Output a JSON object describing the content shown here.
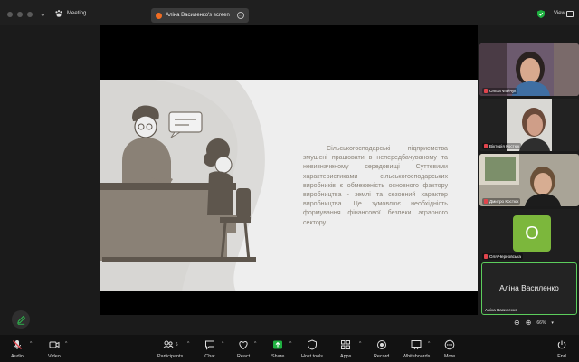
{
  "window": {
    "title": "Meeting",
    "share_pill": "Аліна Василенко's screen",
    "view_label": "View"
  },
  "slide": {
    "paragraph": "Сільськогосподарські підприємства змушені працювати в непередбачуваному та невизначеному середовищі Суттєвими характеристиками сільськогосподарських виробників є обмеженість основного фактору виробництва - землі та сезонний характер виробництва. Це зумовлює необхідність формування фінансової безпеки аграрного сектору."
  },
  "participants": [
    {
      "name": "Ольга Файчук",
      "muted": true
    },
    {
      "name": "Вікторія Костюк",
      "muted": true
    },
    {
      "name": "Дмитро Костюк",
      "muted": true
    },
    {
      "name": "Оля Черновська",
      "muted": true,
      "avatar_letter": "О"
    },
    {
      "name": "Аліна Василенко",
      "muted": false,
      "speaking": true
    }
  ],
  "zoom": {
    "level": "66%"
  },
  "toolbar": {
    "audio": "Audio",
    "video": "Video",
    "participants": "Participants",
    "participants_count": "6",
    "chat": "Chat",
    "react": "React",
    "share": "Share",
    "host_tools": "Host tools",
    "apps": "Apps",
    "record": "Record",
    "whiteboards": "Whiteboards",
    "more": "More",
    "end": "End"
  },
  "colors": {
    "share_green": "#1fb141",
    "end_red": "#e0444c",
    "active_border": "#5ccd5c",
    "avatar_green": "#7cb73c"
  }
}
